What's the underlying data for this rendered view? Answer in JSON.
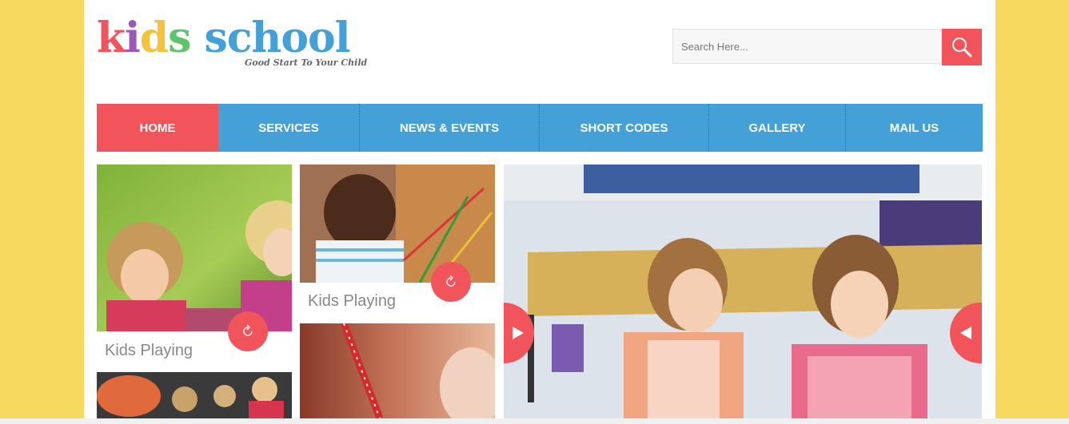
{
  "logo": {
    "letters": [
      {
        "char": "k",
        "color": "#f2545b"
      },
      {
        "char": "i",
        "color": "#9b59b6"
      },
      {
        "char": "d",
        "color": "#f5c33b"
      },
      {
        "char": "s",
        "color": "#5cc46a"
      },
      {
        "char": " ",
        "color": "#ffffff"
      },
      {
        "char": "s",
        "color": "#44a0d6"
      },
      {
        "char": "c",
        "color": "#44a0d6"
      },
      {
        "char": "h",
        "color": "#44a0d6"
      },
      {
        "char": "o",
        "color": "#44a0d6"
      },
      {
        "char": "o",
        "color": "#44a0d6"
      },
      {
        "char": "l",
        "color": "#44a0d6"
      }
    ],
    "tagline": "Good Start To Your Child"
  },
  "search": {
    "placeholder": "Search Here...",
    "value": "",
    "button_icon": "search-icon"
  },
  "nav": {
    "items": [
      {
        "label": "HOME",
        "active": true
      },
      {
        "label": "SERVICES",
        "active": false
      },
      {
        "label": "NEWS & EVENTS",
        "active": false
      },
      {
        "label": "SHORT CODES",
        "active": false
      },
      {
        "label": "GALLERY",
        "active": false
      },
      {
        "label": "MAIL US",
        "active": false
      }
    ]
  },
  "gallery": {
    "tiles": [
      {
        "caption": "Kids Playing",
        "button_icon": "refresh-icon"
      },
      {
        "caption": "Kids Playing",
        "button_icon": "refresh-icon"
      }
    ]
  },
  "slider": {
    "prev_icon": "play-right-icon",
    "next_icon": "play-left-icon"
  },
  "colors": {
    "background": "#f6d95e",
    "accent_red": "#f2545b",
    "nav_blue": "#44a0d6"
  }
}
